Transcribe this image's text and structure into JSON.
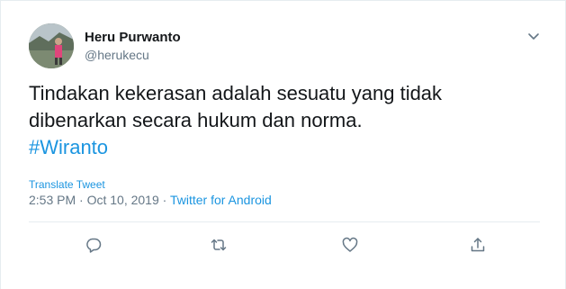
{
  "tweet": {
    "author_name": "Heru Purwanto",
    "author_handle": "@herukecu",
    "text_line1": "Tindakan kekerasan adalah sesuatu yang tidak",
    "text_line2": "dibenarkan secara hukum dan norma.",
    "hashtag": "#Wiranto",
    "translate_label": "Translate Tweet",
    "time": "2:53 PM",
    "date": "Oct 10, 2019",
    "separator": "·",
    "source": "Twitter for Android"
  },
  "icons": {
    "menu": "chevron-down-icon",
    "reply": "reply-icon",
    "retweet": "retweet-icon",
    "like": "heart-icon",
    "share": "share-icon"
  },
  "colors": {
    "text": "#14171a",
    "secondary": "#657786",
    "link": "#1b95e0",
    "divider": "#e6ecf0"
  }
}
